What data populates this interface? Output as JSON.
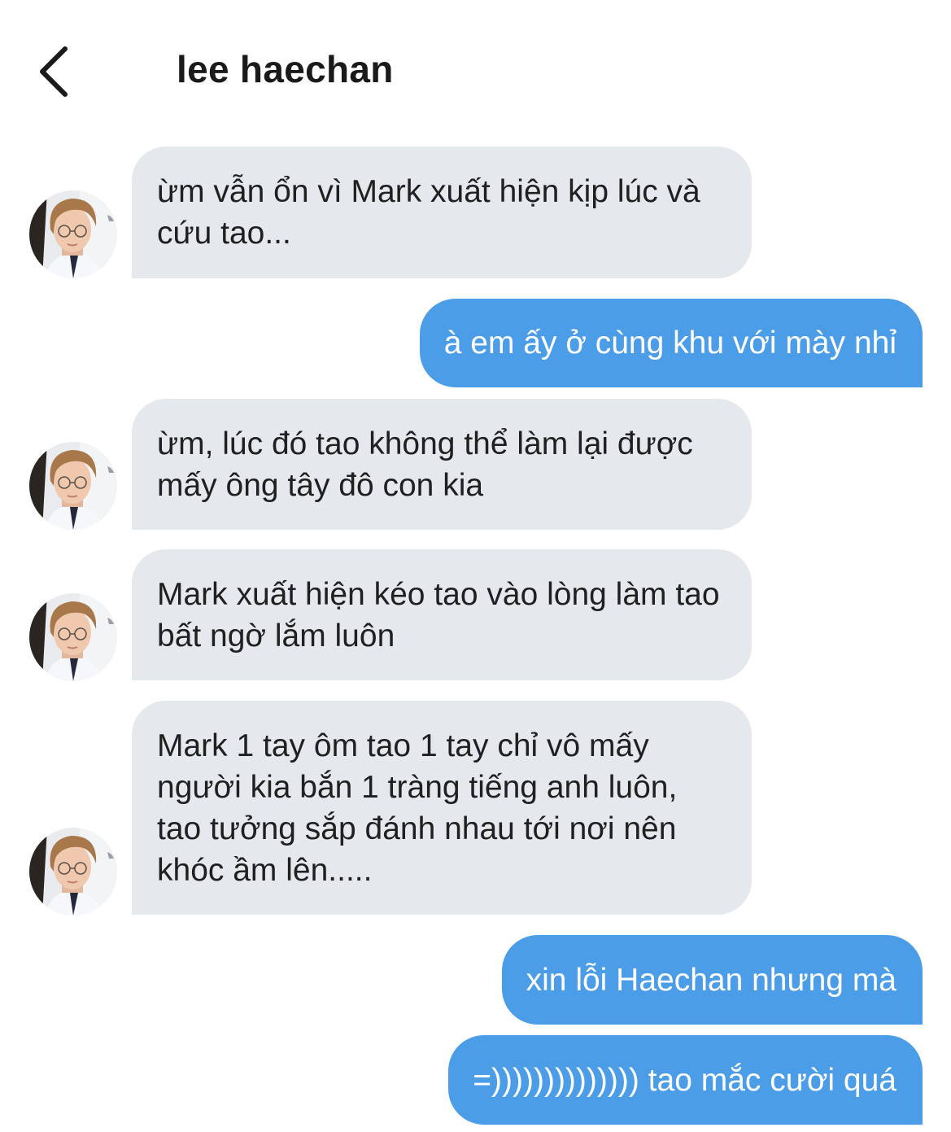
{
  "header": {
    "title": "lee haechan",
    "back_icon": "chevron-left-icon"
  },
  "messages": [
    {
      "sender": "lee haechan",
      "text": "ừm vẫn ổn vì Mark xuất hiện kịp lúc và cứu tao..."
    },
    {
      "sender": "me",
      "text": "à em ấy ở cùng khu với mày nhỉ"
    },
    {
      "sender": "lee haechan",
      "text": "ừm, lúc đó tao không thể làm lại được mấy ông tây đô con kia"
    },
    {
      "sender": "lee haechan",
      "text": "Mark xuất hiện kéo tao vào lòng làm tao bất ngờ lắm luôn"
    },
    {
      "sender": "lee haechan",
      "text": "Mark 1 tay ôm tao 1 tay chỉ vô mấy người kia bắn 1 tràng tiếng anh luôn, tao tưởng sắp đánh nhau tới nơi nên khóc ầm lên....."
    },
    {
      "sender": "me",
      "text": "xin lỗi Haechan nhưng mà"
    },
    {
      "sender": "me",
      "text": "=)))))))))))))) tao mắc cười quá"
    }
  ],
  "colors": {
    "incoming_bubble": "#e5e9ee",
    "outgoing_bubble": "#4c9de8",
    "outgoing_text": "#ffffff"
  }
}
